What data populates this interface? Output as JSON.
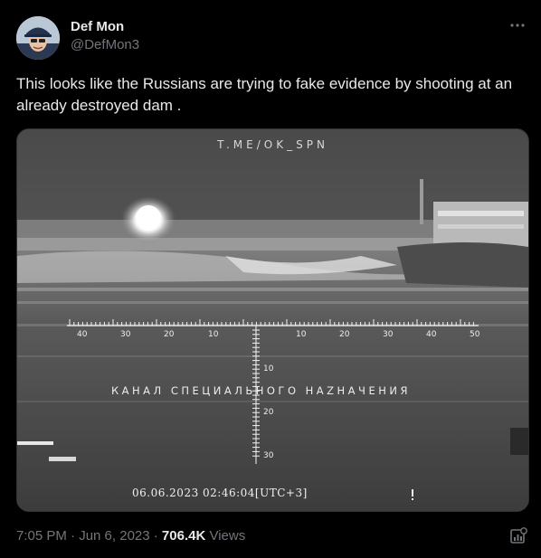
{
  "author": {
    "name": "Def Mon",
    "handle": "@DefMon3"
  },
  "tweet": {
    "text": "This looks like the Russians are trying to fake evidence by shooting at an already destroyed dam ."
  },
  "media": {
    "watermark": "T.ME/OK_SPN",
    "channel_caption": "КАНАЛ СПЕЦИАЛЬНОГО НАZНАЧЕНИЯ",
    "timestamp": "06.06.2023  02:46:04[UTC+3]",
    "horizontal_scale": [
      "40",
      "30",
      "20",
      "10",
      "10",
      "20",
      "30",
      "40",
      "50"
    ],
    "vertical_scale": [
      "10",
      "20",
      "30"
    ]
  },
  "meta": {
    "time": "7:05 PM · Jun 6, 2023 · ",
    "views_count": "706.4K",
    "views_label": " Views"
  },
  "icons": {
    "more": "more-icon",
    "analytics": "analytics-icon"
  }
}
